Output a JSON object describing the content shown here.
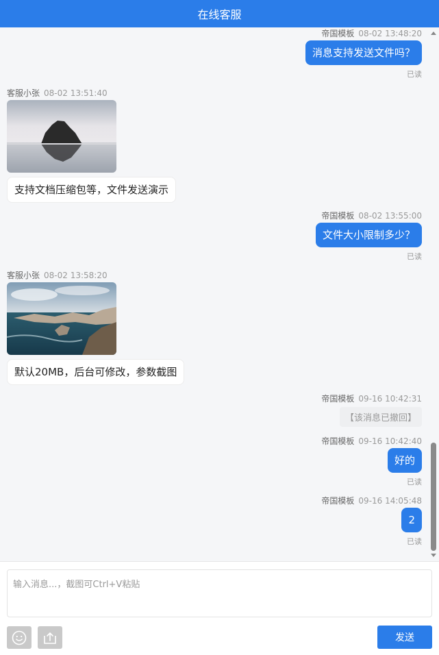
{
  "header": {
    "title": "在线客服"
  },
  "messages": [
    {
      "sender": "帝国模板",
      "time": "08-02 13:48:20",
      "text": "消息支持发送文件吗？",
      "status": "已读"
    },
    {
      "sender": "客服小张",
      "time": "08-02 13:51:40",
      "image": "island-rock-lake-photo",
      "text": "支持文档压缩包等，文件发送演示"
    },
    {
      "sender": "帝国模板",
      "time": "08-02 13:55:00",
      "text": "文件大小限制多少？",
      "status": "已读"
    },
    {
      "sender": "客服小张",
      "time": "08-02 13:58:20",
      "image": "coastal-cliffs-ocean-photo",
      "text": "默认20MB，后台可修改，参数截图"
    },
    {
      "sender": "帝国模板",
      "time": "09-16 10:42:31",
      "text": "【该消息已撤回】"
    },
    {
      "sender": "帝国模板",
      "time": "09-16 10:42:40",
      "text": "好的",
      "status": "已读"
    },
    {
      "sender": "帝国模板",
      "time": "09-16 14:05:48",
      "text": "2",
      "status": "已读"
    }
  ],
  "composer": {
    "placeholder": "输入消息...，截图可Ctrl+V粘贴",
    "emoji_icon": "smiley-icon",
    "upload_icon": "upload-icon",
    "send_label": "发送"
  },
  "colors": {
    "primary": "#2b7de9",
    "chat_bg": "#f5f6f8"
  }
}
